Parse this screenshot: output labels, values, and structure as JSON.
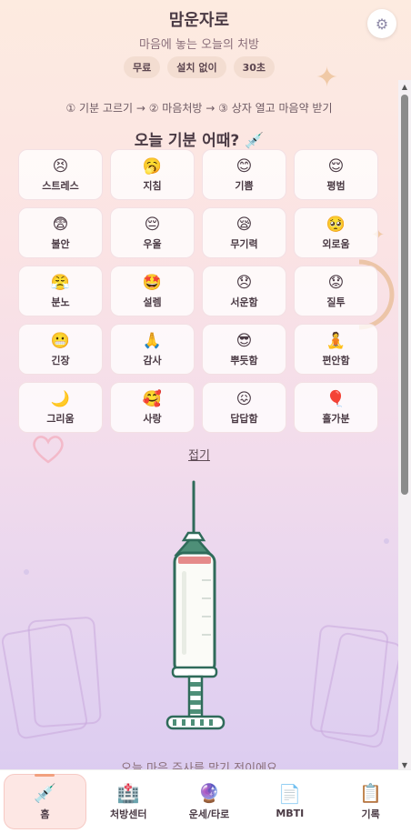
{
  "header": {
    "title": "맘운자로",
    "subtitle": "마음에 놓는 오늘의 처방",
    "chips": [
      "무료",
      "설치 없이",
      "30초"
    ],
    "settings_icon": "gear-icon"
  },
  "steps": "① 기분 고르기 → ② 마음처방 → ③ 상자 열고 마음약 받기",
  "question": "오늘 기분 어때? 💉",
  "moods": [
    {
      "emoji": "😣",
      "label": "스트레스"
    },
    {
      "emoji": "🥱",
      "label": "지침"
    },
    {
      "emoji": "😊",
      "label": "기쁨"
    },
    {
      "emoji": "😌",
      "label": "평범"
    },
    {
      "emoji": "😨",
      "label": "불안"
    },
    {
      "emoji": "😔",
      "label": "우울"
    },
    {
      "emoji": "😪",
      "label": "무기력"
    },
    {
      "emoji": "🥺",
      "label": "외로움"
    },
    {
      "emoji": "😤",
      "label": "분노"
    },
    {
      "emoji": "🤩",
      "label": "설렘"
    },
    {
      "emoji": "😞",
      "label": "서운함"
    },
    {
      "emoji": "😟",
      "label": "질투"
    },
    {
      "emoji": "😬",
      "label": "긴장"
    },
    {
      "emoji": "🙏",
      "label": "감사"
    },
    {
      "emoji": "😎",
      "label": "뿌듯함"
    },
    {
      "emoji": "🧘",
      "label": "편안함"
    },
    {
      "emoji": "🌙",
      "label": "그리움"
    },
    {
      "emoji": "🥰",
      "label": "사랑"
    },
    {
      "emoji": "😖",
      "label": "답답함"
    },
    {
      "emoji": "🎈",
      "label": "홀가분"
    }
  ],
  "collapse_label": "접기",
  "bottom_text": "오늘 마음 주사를 맞기 전이에요",
  "nav": [
    {
      "icon": "💉",
      "label": "홈",
      "active": true
    },
    {
      "icon": "🏥",
      "label": "처방센터",
      "active": false
    },
    {
      "icon": "🔮",
      "label": "운세/타로",
      "active": false
    },
    {
      "icon": "📄",
      "label": "MBTI",
      "active": false
    },
    {
      "icon": "📋",
      "label": "기록",
      "active": false
    }
  ],
  "colors": {
    "accent": "#f2a07e",
    "syringe_outline": "#2f6b5a",
    "liquid": "#e58a8a"
  }
}
